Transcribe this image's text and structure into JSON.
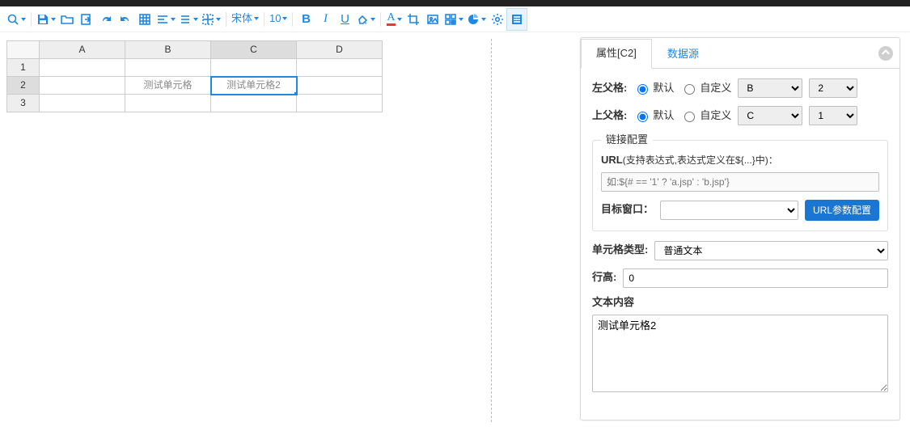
{
  "toolbar": {
    "font_name": "宋体",
    "font_size": "10",
    "bold": "B",
    "italic": "I",
    "underline": "U",
    "text_color_letter": "A"
  },
  "sheet": {
    "columns": [
      "A",
      "B",
      "C",
      "D"
    ],
    "rows": [
      "1",
      "2",
      "3"
    ],
    "cells": {
      "B2": "测试单元格",
      "C2": "测试单元格2"
    },
    "selected": "C2"
  },
  "panel": {
    "tab_props": "属性[C2]",
    "tab_ds": "数据源",
    "left_parent": {
      "label": "左父格:",
      "opt_default": "默认",
      "opt_custom": "自定义",
      "col": "B",
      "row": "2"
    },
    "top_parent": {
      "label": "上父格:",
      "opt_default": "默认",
      "opt_custom": "自定义",
      "col": "C",
      "row": "1"
    },
    "link": {
      "legend": "链接配置",
      "url_label": "URL",
      "url_sub": "(支持表达式,表达式定义在${...}中)：",
      "url_placeholder": "如:${# == '1' ? 'a.jsp' : 'b.jsp'}",
      "target_label": "目标窗口：",
      "target_value": "",
      "param_btn": "URL参数配置"
    },
    "cell_type": {
      "label": "单元格类型:",
      "value": "普通文本"
    },
    "row_height": {
      "label": "行高:",
      "value": "0"
    },
    "text_content": {
      "label": "文本内容",
      "value": "测试单元格2"
    }
  }
}
